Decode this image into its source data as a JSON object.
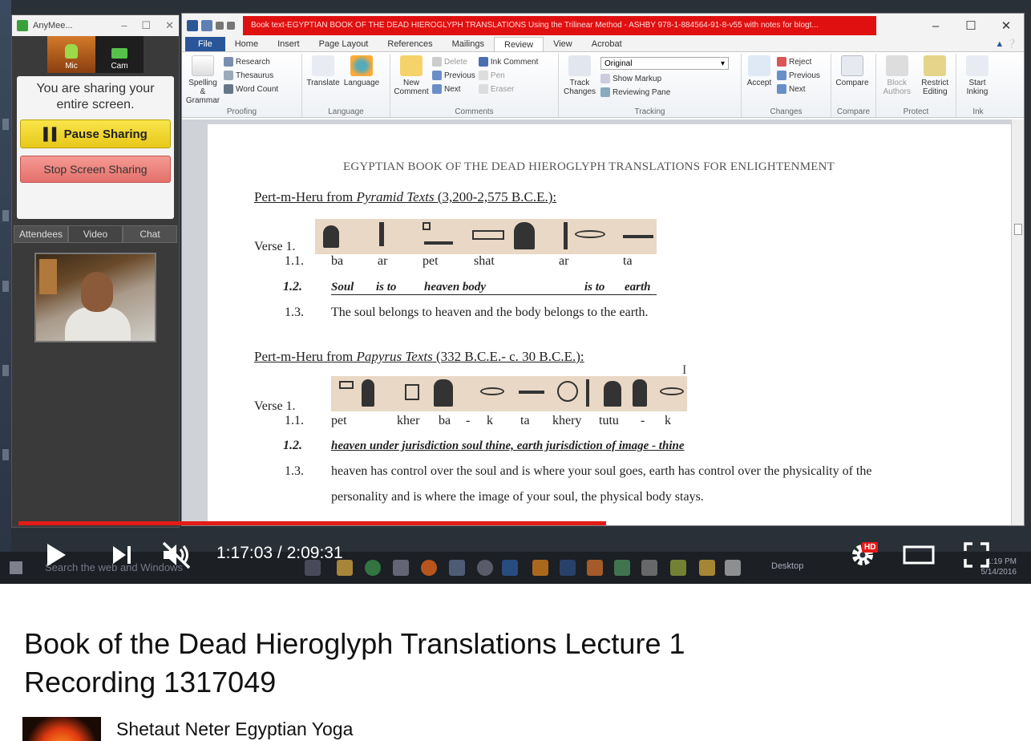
{
  "anymeeting": {
    "title": "AnyMee...",
    "mic_label": "Mic",
    "cam_label": "Cam",
    "share_message": "You are sharing your entire screen.",
    "pause_label": "▌▌ Pause Sharing",
    "stop_label": "Stop Screen Sharing",
    "tabs": [
      "Attendees",
      "Video",
      "Chat"
    ]
  },
  "word": {
    "title": "Book text-EGYPTIAN BOOK OF THE DEAD HIEROGLYPH TRANSLATIONS Using the Trilinear Method - ASHBY 978-1-884564-91-8-v55 with notes for blogt...",
    "window_controls": [
      "–",
      "☐",
      "✕"
    ],
    "ribbon_tabs": [
      "File",
      "Home",
      "Insert",
      "Page Layout",
      "References",
      "Mailings",
      "Review",
      "View",
      "Acrobat"
    ],
    "active_tab": "Review",
    "ribbon": {
      "proofing": {
        "label": "Proofing",
        "spelling": "Spelling & Grammar",
        "research": "Research",
        "thesaurus": "Thesaurus",
        "word_count": "Word Count"
      },
      "language": {
        "label": "Language",
        "translate": "Translate",
        "language": "Language"
      },
      "comments": {
        "label": "Comments",
        "new_comment": "New Comment",
        "delete": "Delete",
        "previous": "Previous",
        "next": "Next",
        "ink_comment": "Ink Comment",
        "pen": "Pen",
        "eraser": "Eraser"
      },
      "tracking": {
        "label": "Tracking",
        "track_changes": "Track Changes",
        "markup": "Original",
        "show_markup": "Show Markup",
        "reviewing_pane": "Reviewing Pane"
      },
      "changes": {
        "label": "Changes",
        "accept": "Accept",
        "reject": "Reject",
        "previous": "Previous",
        "next": "Next"
      },
      "compare": {
        "label": "Compare",
        "compare": "Compare"
      },
      "protect": {
        "label": "Protect",
        "block_authors": "Block Authors",
        "restrict_editing": "Restrict Editing"
      },
      "ink": {
        "label": "Ink",
        "start_inking": "Start Inking"
      }
    },
    "document": {
      "header": "EGYPTIAN BOOK OF THE DEAD HIEROGLYPH TRANSLATIONS FOR ENLIGHTENMENT",
      "sections": [
        {
          "heading_prefix": "Pert-m-Heru from ",
          "heading_source": "Pyramid Texts",
          "heading_suffix": " (3,200-2,575 B.C.E.):",
          "verse": "Verse 1.",
          "n1": "1.1.",
          "n2": "1.2.",
          "n3": "1.3.",
          "translit": [
            "ba",
            "ar",
            "pet",
            "shat",
            "ar",
            "ta"
          ],
          "literal": [
            "Soul",
            "is to",
            "heaven body",
            "is to",
            "earth"
          ],
          "meaning": "The soul belongs to heaven and the body belongs to the earth."
        },
        {
          "heading_prefix": "Pert-m-Heru from ",
          "heading_source": "Papyrus Texts",
          "heading_suffix": " (332 B.C.E.- c. 30 B.C.E.):",
          "verse": "Verse 1.",
          "n1": "1.1.",
          "n2": "1.2.",
          "n3": "1.3.",
          "translit": [
            "pet",
            "kher",
            "ba",
            "-",
            "k",
            "ta",
            "khery",
            "tutu",
            "-",
            "k"
          ],
          "literal": "heaven under jurisdiction soul thine, earth jurisdiction of image - thine",
          "meaning_line1": "heaven has control over the soul and is where your soul goes, earth has control over the physicality of the",
          "meaning_line2": "personality and is where the image of your soul, the physical body stays."
        }
      ]
    }
  },
  "taskbar": {
    "search_placeholder": "Search the web and Windows",
    "desktop_label": "Desktop",
    "time": "1:19 PM",
    "date": "5/14/2016"
  },
  "player": {
    "current_time": "1:17:03",
    "duration": "2:09:31",
    "time_display": "1:17:03 / 2:09:31",
    "played_fraction": 0.595,
    "buffered_fraction": 0.603,
    "hd_badge": "HD",
    "accent_color": "#e41b17"
  },
  "video": {
    "title": "Book of the Dead Hieroglyph Translations Lecture 1 Recording 1317049",
    "channel_name": "Shetaut Neter Egyptian Yoga"
  }
}
